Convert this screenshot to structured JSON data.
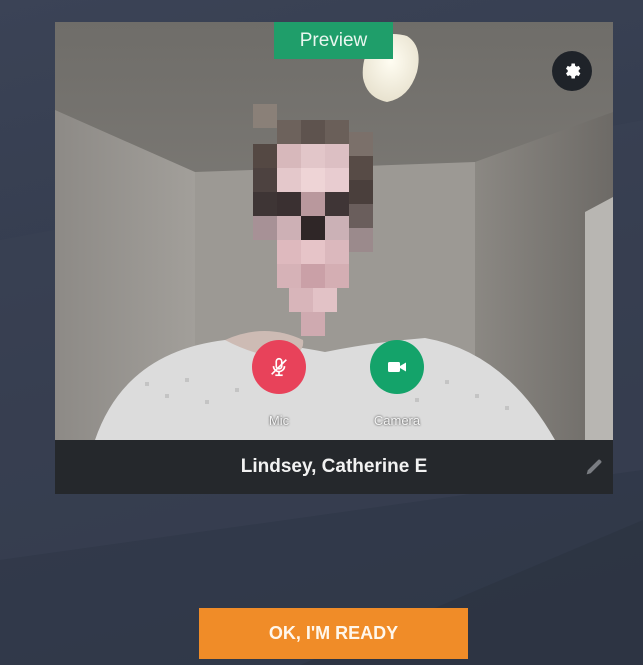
{
  "preview": {
    "badge_label": "Preview",
    "settings_icon": "gear-icon"
  },
  "controls": {
    "mic": {
      "label": "Mic",
      "icon": "microphone-muted-icon",
      "state": "muted",
      "color": "#e8425a"
    },
    "camera": {
      "label": "Camera",
      "icon": "video-camera-icon",
      "state": "on",
      "color": "#14a36a"
    }
  },
  "participant": {
    "name": "Lindsey, Catherine E",
    "edit_icon": "pencil-icon"
  },
  "actions": {
    "ready_label": "OK, I'M READY",
    "ready_color": "#f08c28"
  },
  "colors": {
    "background": "#363e50",
    "accent_green": "#1f9e6a",
    "name_bar": "#25282c"
  }
}
